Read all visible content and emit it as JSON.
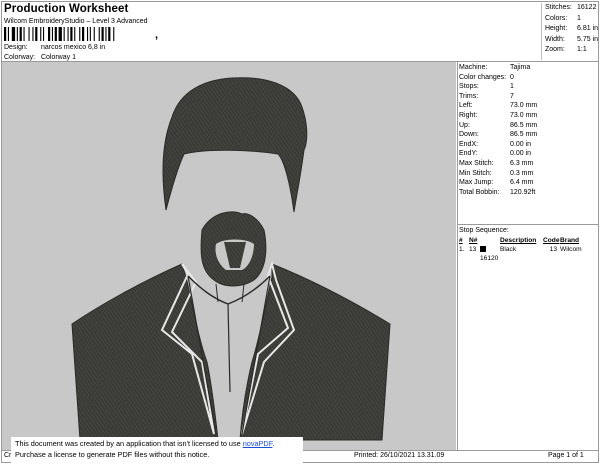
{
  "header": {
    "title": "Production Worksheet",
    "software": "Wilcom EmbroideryStudio – Level 3 Advanced",
    "design_label": "Design:",
    "design_value": "narcos mexico 6,8 in",
    "colorway_label": "Colorway:",
    "colorway_value": "Colorway 1"
  },
  "stats": [
    {
      "label": "Stitches:",
      "value": "16122"
    },
    {
      "label": "Colors:",
      "value": "1"
    },
    {
      "label": "Height:",
      "value": "6.81 in"
    },
    {
      "label": "Width:",
      "value": "5.75 in"
    },
    {
      "label": "Zoom:",
      "value": "1:1"
    }
  ],
  "machine_info": [
    {
      "label": "Machine:",
      "value": "Tajima"
    },
    {
      "label": "Color changes:",
      "value": "0"
    },
    {
      "label": "Stops:",
      "value": "1"
    },
    {
      "label": "Trims:",
      "value": "7"
    },
    {
      "label": "Left:",
      "value": "73.0 mm"
    },
    {
      "label": "Right:",
      "value": "73.0 mm"
    },
    {
      "label": "Up:",
      "value": "86.5 mm"
    },
    {
      "label": "Down:",
      "value": "86.5 mm"
    },
    {
      "label": "EndX:",
      "value": "0.00 in"
    },
    {
      "label": "EndY:",
      "value": "0.00 in"
    },
    {
      "label": "Max Stitch:",
      "value": "6.3 mm"
    },
    {
      "label": "Min Stitch:",
      "value": "0.3 mm"
    },
    {
      "label": "Max Jump:",
      "value": "6.4 mm"
    },
    {
      "label": "Total Bobbin:",
      "value": "120.92ft"
    }
  ],
  "stop_sequence": {
    "title": "Stop Sequence:",
    "headers": [
      "#",
      "N#",
      "",
      "Description",
      "Code",
      "Brand"
    ],
    "rows": [
      {
        "num": "1.",
        "n": "13",
        "stitches": "16120",
        "description": "Black",
        "code": "13",
        "brand": "Wilcom",
        "color": "#000000"
      }
    ]
  },
  "footer": {
    "left": "Cr",
    "printed": "Printed: 26/10/2021 13.31.09",
    "page": "Page 1 of 1"
  },
  "notice": {
    "line1_pre": "This document was created by an application that isn't licensed to use ",
    "line1_link": "novaPDF",
    "line1_post": ".",
    "line2": "Purchase a license to generate PDF files without this notice."
  },
  "colors": {
    "background_swatch": "#c8c8c8",
    "thread": "#3a3a36"
  }
}
